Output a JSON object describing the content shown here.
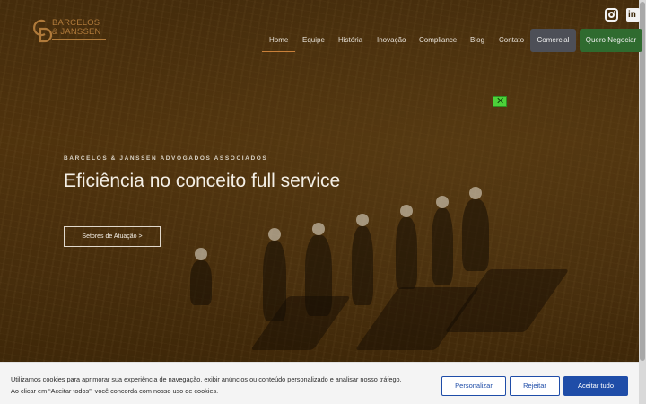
{
  "brand": {
    "logo_line1": "BARCELOS",
    "logo_line2": "& JANSSEN"
  },
  "social": {
    "instagram_icon": "instagram-icon",
    "linkedin_icon": "linkedin-icon",
    "linkedin_glyph": "in"
  },
  "nav": {
    "items": [
      {
        "label": "Home"
      },
      {
        "label": "Equipe"
      },
      {
        "label": "História"
      },
      {
        "label": "Inovação"
      },
      {
        "label": "Compliance"
      },
      {
        "label": "Blog"
      },
      {
        "label": "Contato"
      }
    ],
    "comercial_label": "Comercial",
    "negociar_label": "Quero Negociar"
  },
  "hero": {
    "eyebrow": "BARCELOS & JANSSEN ADVOGADOS ASSOCIADOS",
    "headline": "Eficiência no conceito full service",
    "cta_label": "Setores de Atuação >"
  },
  "overlay_close_glyph": "✕",
  "cookie": {
    "line1": "Utilizamos cookies para aprimorar sua experiência de navegação, exibir anúncios ou conteúdo personalizado e analisar nosso tráfego.",
    "line2": "Ao clicar em “Aceitar todos”, você concorda com nosso uso de cookies.",
    "customize_label": "Personalizar",
    "reject_label": "Rejeitar",
    "accept_label": "Aceitar tudo"
  },
  "colors": {
    "accent_copper": "#c9803a",
    "comercial_bg": "#4d4f57",
    "negociar_bg": "#2f6b2f",
    "cookie_primary": "#1f4da8"
  }
}
